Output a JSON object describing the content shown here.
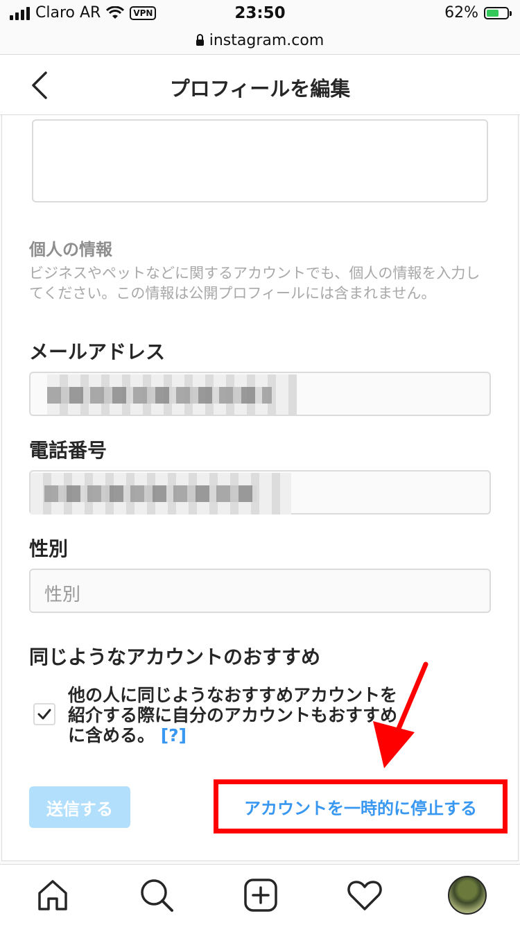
{
  "status_bar": {
    "carrier": "Claro AR",
    "vpn": "VPN",
    "time": "23:50",
    "battery": "62%",
    "battery_level": 0.62
  },
  "browser": {
    "url": "instagram.com"
  },
  "header": {
    "title": "プロフィールを編集"
  },
  "personal_info": {
    "heading": "個人の情報",
    "description": "ビジネスやペットなどに関するアカウントでも、個人の情報を入力してください。この情報は公開プロフィールには含まれません。"
  },
  "email": {
    "label": "メールアドレス"
  },
  "phone": {
    "label": "電話番号"
  },
  "gender": {
    "label": "性別",
    "placeholder": "性別"
  },
  "recommendations": {
    "title": "同じようなアカウントのおすすめ",
    "checkbox_text": "他の人に同じようなおすすめアカウントを紹介する際に自分のアカウントもおすすめに含める。",
    "help": "[?]",
    "checked": true
  },
  "actions": {
    "submit": "送信する",
    "deactivate": "アカウントを一時的に停止する"
  },
  "colors": {
    "accent": "#3897f0",
    "submit_disabled": "#b2dffc",
    "highlight": "#ff0000"
  },
  "nav": {
    "icons": [
      "home-icon",
      "search-icon",
      "new-post-icon",
      "activity-heart-icon",
      "profile-avatar"
    ]
  }
}
